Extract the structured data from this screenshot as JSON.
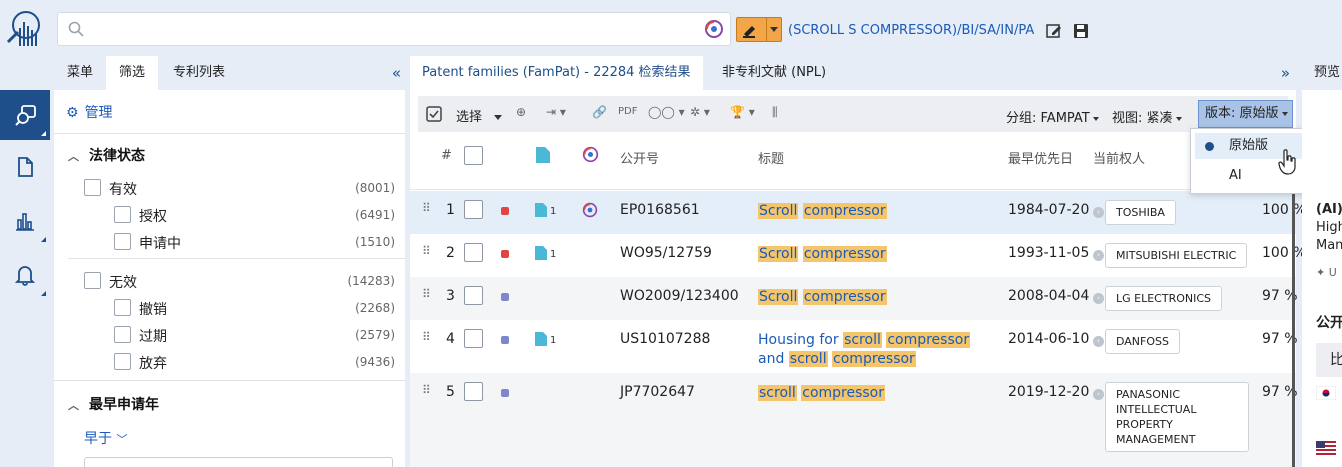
{
  "search": {
    "value": "",
    "placeholder": ""
  },
  "query_text": "(SCROLL S COMPRESSOR)/BI/SA/IN/PA",
  "filter_panel": {
    "tabs": [
      "菜单",
      "筛选",
      "专利列表"
    ],
    "manage": "管理",
    "legal_status": {
      "title": "法律状态",
      "groups": [
        {
          "label": "有效",
          "count": "(8001)",
          "children": [
            {
              "label": "授权",
              "count": "(6491)"
            },
            {
              "label": "申请中",
              "count": "(1510)"
            }
          ]
        },
        {
          "label": "无效",
          "count": "(14283)",
          "children": [
            {
              "label": "撤销",
              "count": "(2268)"
            },
            {
              "label": "过期",
              "count": "(2579)"
            },
            {
              "label": "放弃",
              "count": "(9436)"
            }
          ]
        }
      ]
    },
    "earliest_app_year": {
      "title": "最早申请年",
      "mode": "早于"
    }
  },
  "results": {
    "tabs": [
      "Patent families (FamPat) - 22284 检索结果",
      "非专利文献 (NPL)"
    ],
    "toolbar": {
      "select": "选择",
      "group": "分组: FAMPAT",
      "view": "视图: 紧凑",
      "version": "版本: 原始版"
    },
    "version_menu": [
      "原始版",
      "AI"
    ],
    "headers": {
      "index": "#",
      "pubno": "公开号",
      "title": "标题",
      "priority": "最早优先日",
      "owner": "当前权人"
    },
    "rows": [
      {
        "num": "1",
        "status_color": "#e04444",
        "docs": "1",
        "ai": true,
        "pubno": "EP0168561",
        "title": [
          {
            "t": "Scroll",
            "h": true
          },
          {
            "t": " ",
            "h": false
          },
          {
            "t": "compressor",
            "h": true
          }
        ],
        "priority": "1984-07-20",
        "owner": "TOSHIBA",
        "score": "100 %"
      },
      {
        "num": "2",
        "status_color": "#e04444",
        "docs": "1",
        "ai": false,
        "pubno": "WO95/12759",
        "title": [
          {
            "t": "Scroll",
            "h": true
          },
          {
            "t": " ",
            "h": false
          },
          {
            "t": "compressor",
            "h": true
          }
        ],
        "priority": "1993-11-05",
        "owner": "MITSUBISHI ELECTRIC",
        "score": "100 %"
      },
      {
        "num": "3",
        "status_color": "#7f86c9",
        "docs": "",
        "ai": false,
        "pubno": "WO2009/123400",
        "title": [
          {
            "t": "Scroll",
            "h": true
          },
          {
            "t": " ",
            "h": false
          },
          {
            "t": "compressor",
            "h": true
          }
        ],
        "priority": "2008-04-04",
        "owner": "LG ELECTRONICS",
        "score": "97 %"
      },
      {
        "num": "4",
        "status_color": "#7f86c9",
        "docs": "1",
        "ai": false,
        "pubno": "US10107288",
        "title": [
          {
            "t": "Housing for ",
            "h": false
          },
          {
            "t": "scroll",
            "h": true
          },
          {
            "t": " ",
            "h": false
          },
          {
            "t": "compressor",
            "h": true
          },
          {
            "t": " and ",
            "h": false
          },
          {
            "t": "scroll",
            "h": true
          },
          {
            "t": " ",
            "h": false
          },
          {
            "t": "compressor",
            "h": true
          }
        ],
        "priority": "2014-06-10",
        "owner": "DANFOSS",
        "score": "97 %"
      },
      {
        "num": "5",
        "status_color": "#7f86c9",
        "docs": "",
        "ai": false,
        "pubno": "JP7702647",
        "title": [
          {
            "t": "scroll",
            "h": true
          },
          {
            "t": " ",
            "h": false
          },
          {
            "t": "compressor",
            "h": true
          }
        ],
        "priority": "2019-12-20",
        "owner": "PANASONIC\nINTELLECTUAL\nPROPERTY\nMANAGEMENT",
        "score": "97 %"
      }
    ]
  },
  "preview": {
    "tab": "预览",
    "lines": [
      "(AI)",
      "High",
      "Man",
      "✦ U",
      "公开",
      "比"
    ]
  }
}
